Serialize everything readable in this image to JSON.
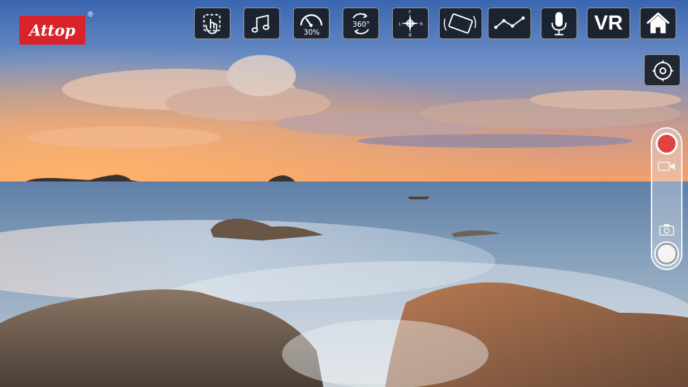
{
  "brand": {
    "logo_text": "Attop",
    "registered_mark": "®"
  },
  "toolbar": {
    "speed_percent_label": "30%",
    "rotate_label": "360°",
    "compass_letters": {
      "left": "L",
      "right": "R",
      "front": "F",
      "back": "B"
    },
    "vr_label": "VR"
  },
  "colors": {
    "record_red": "#e0443f",
    "toolbar_bg": "#16181e",
    "logo_red": "#d8232a"
  }
}
